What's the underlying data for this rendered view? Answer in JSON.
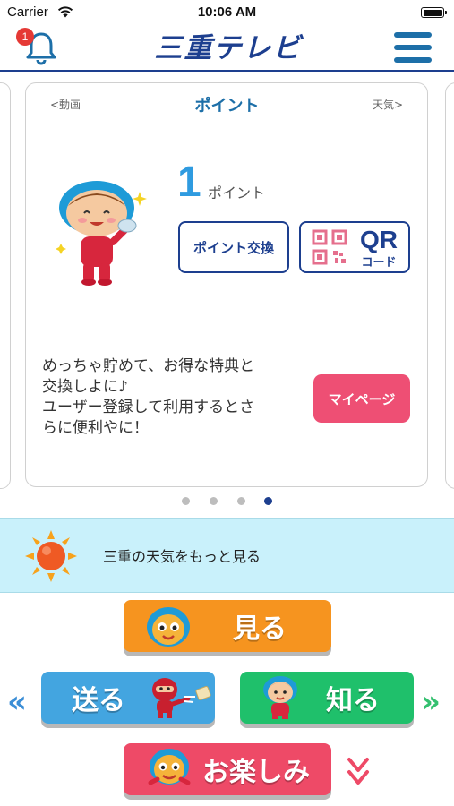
{
  "status_bar": {
    "carrier": "Carrier",
    "time": "10:06 AM"
  },
  "header": {
    "logo_text": "三重テレビ",
    "notification_count": "1",
    "brand_color": "#1d3f8f"
  },
  "card": {
    "prev_label": "<動画",
    "title": "ポイント",
    "next_label": "天気>",
    "points_value": "1",
    "points_unit": "ポイント",
    "exchange_button": "ポイント交換",
    "qr_button": {
      "label": "QR",
      "sublabel": "コード"
    },
    "message_lines": [
      "めっちゃ貯めて、お得な特典と",
      "交換しよに♪",
      "ユーザー登録して利用するとさ",
      "らに便利やに！"
    ],
    "mypage_button": "マイページ"
  },
  "pagination": {
    "total": 4,
    "active_index": 3,
    "active_color": "#1d3f8f"
  },
  "weather": {
    "label": "三重の天気をもっと見る"
  },
  "nav_buttons": {
    "miru": "見る",
    "okuru": "送る",
    "shiru": "知る",
    "tanoshimi": "お楽しみ"
  },
  "icons": [
    "bell-icon",
    "menu-icon",
    "wifi-icon",
    "battery-icon",
    "qr-code-icon",
    "sun-icon",
    "mascot-icon",
    "ninja-mascot-icon",
    "chevron-double-left-icon",
    "chevron-double-right-icon",
    "chevron-double-down-icon"
  ],
  "colors": {
    "orange": "#f6941f",
    "blue": "#43a5e0",
    "green": "#1fc06b",
    "pink": "#ee4a67",
    "accent": "#1d6fa8"
  }
}
